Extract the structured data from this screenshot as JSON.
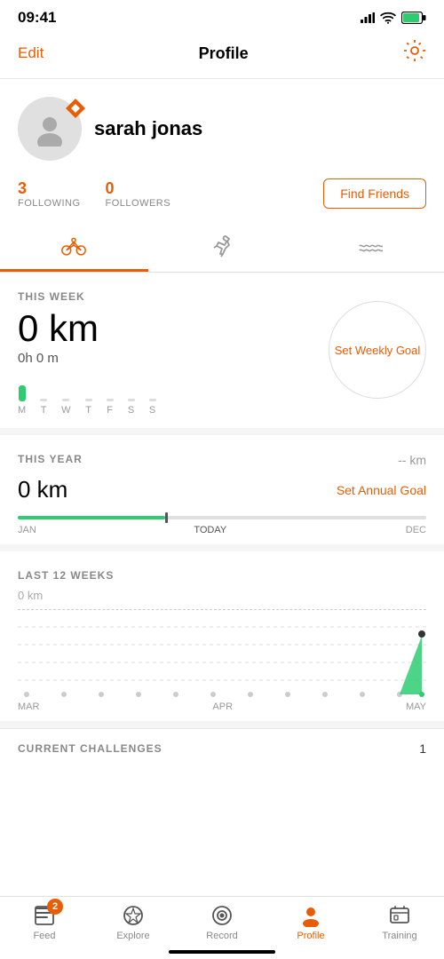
{
  "statusBar": {
    "time": "09:41",
    "arrowIcon": "►"
  },
  "header": {
    "editLabel": "Edit",
    "title": "Profile"
  },
  "profile": {
    "name": "sarah jonas",
    "following": "3",
    "followingLabel": "FOLLOWING",
    "followers": "0",
    "followersLabel": "FOLLOWERS",
    "findFriendsLabel": "Find Friends"
  },
  "activityTabs": [
    {
      "id": "cycling",
      "active": true
    },
    {
      "id": "running",
      "active": false
    },
    {
      "id": "swimming",
      "active": false
    }
  ],
  "thisWeek": {
    "sectionLabel": "THIS WEEK",
    "distance": "0 km",
    "time": "0h   0 m",
    "days": [
      "M",
      "T",
      "W",
      "T",
      "F",
      "S",
      "S"
    ],
    "dayHeights": [
      18,
      0,
      0,
      0,
      0,
      0,
      0
    ],
    "goalLabel": "Set Weekly Goal"
  },
  "thisYear": {
    "sectionLabel": "THIS YEAR",
    "kmRight": "-- km",
    "distance": "0 km",
    "goalLabel": "Set Annual Goal",
    "progressPct": 36,
    "labelLeft": "JAN",
    "labelMid": "TODAY",
    "labelRight": "DEC"
  },
  "last12Weeks": {
    "sectionLabel": "LAST 12 WEEKS",
    "zeroLabel": "0 km",
    "labelLeft": "MAR",
    "labelMid": "APR",
    "labelRight": "MAY"
  },
  "currentChallenges": {
    "label": "CURRENT CHALLENGES",
    "count": "1"
  },
  "bottomNav": {
    "items": [
      {
        "id": "feed",
        "label": "Feed",
        "active": false,
        "badge": "2"
      },
      {
        "id": "explore",
        "label": "Explore",
        "active": false,
        "badge": ""
      },
      {
        "id": "record",
        "label": "Record",
        "active": false,
        "badge": ""
      },
      {
        "id": "profile",
        "label": "Profile",
        "active": true,
        "badge": ""
      },
      {
        "id": "training",
        "label": "Training",
        "active": false,
        "badge": ""
      }
    ]
  }
}
